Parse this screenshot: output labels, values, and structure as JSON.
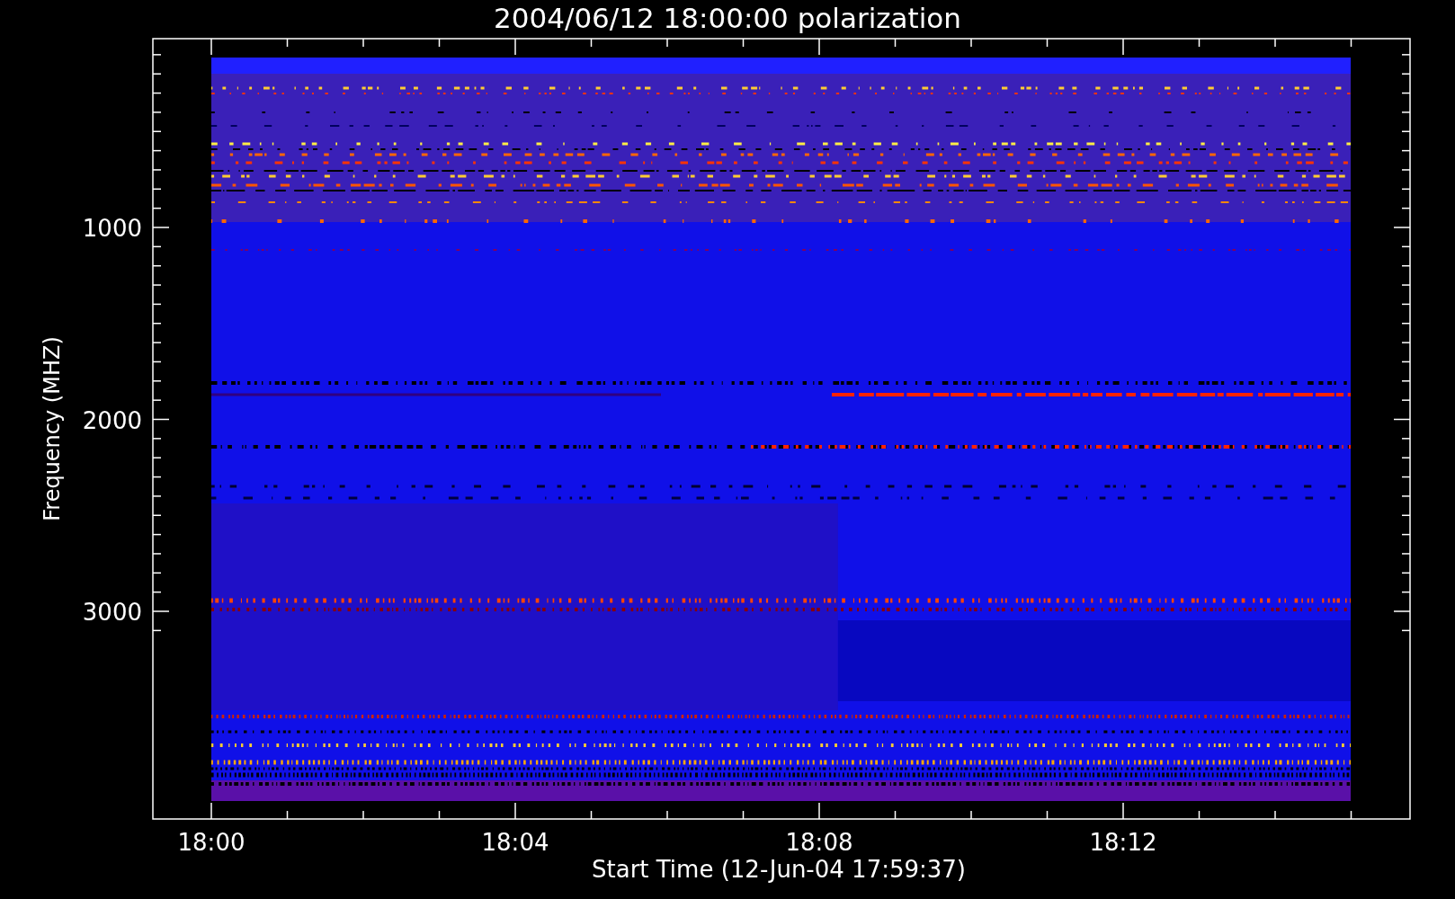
{
  "title": "2004/06/12 18:00:00 polarization",
  "ylabel": "Frequency (MHZ)",
  "xlabel": "Start Time (12-Jun-04 17:59:37)",
  "yticks": [
    "1000",
    "2000",
    "3000"
  ],
  "xticks": [
    "18:00",
    "18:04",
    "18:08",
    "18:12"
  ]
}
